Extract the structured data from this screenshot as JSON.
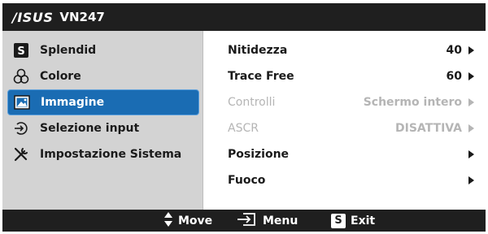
{
  "header": {
    "brand": "/ISUS",
    "model": "VN247"
  },
  "sidebar": {
    "items": [
      {
        "label": "Splendid",
        "icon": "splendid-s-icon",
        "active": false
      },
      {
        "label": "Colore",
        "icon": "color-circles-icon",
        "active": false
      },
      {
        "label": "Immagine",
        "icon": "image-icon",
        "active": true
      },
      {
        "label": "Selezione input",
        "icon": "input-arrow-icon",
        "active": false
      },
      {
        "label": "Impostazione Sistema",
        "icon": "tools-icon",
        "active": false
      }
    ]
  },
  "settings": {
    "rows": [
      {
        "label": "Nitidezza",
        "value": "40",
        "enabled": true
      },
      {
        "label": "Trace Free",
        "value": "60",
        "enabled": true
      },
      {
        "label": "Controlli",
        "value": "Schermo intero",
        "enabled": false
      },
      {
        "label": "ASCR",
        "value": "DISATTIVA",
        "enabled": false
      },
      {
        "label": "Posizione",
        "value": "",
        "enabled": true
      },
      {
        "label": "Fuoco",
        "value": "",
        "enabled": true
      }
    ]
  },
  "footer": {
    "move_label": "Move",
    "menu_label": "Menu",
    "exit_label": "Exit",
    "exit_key": "S"
  },
  "colors": {
    "active": "#1a6cb3",
    "bar": "#1f1f1f",
    "panel": "#d3d3d3",
    "disabled": "#b5b5b5"
  }
}
